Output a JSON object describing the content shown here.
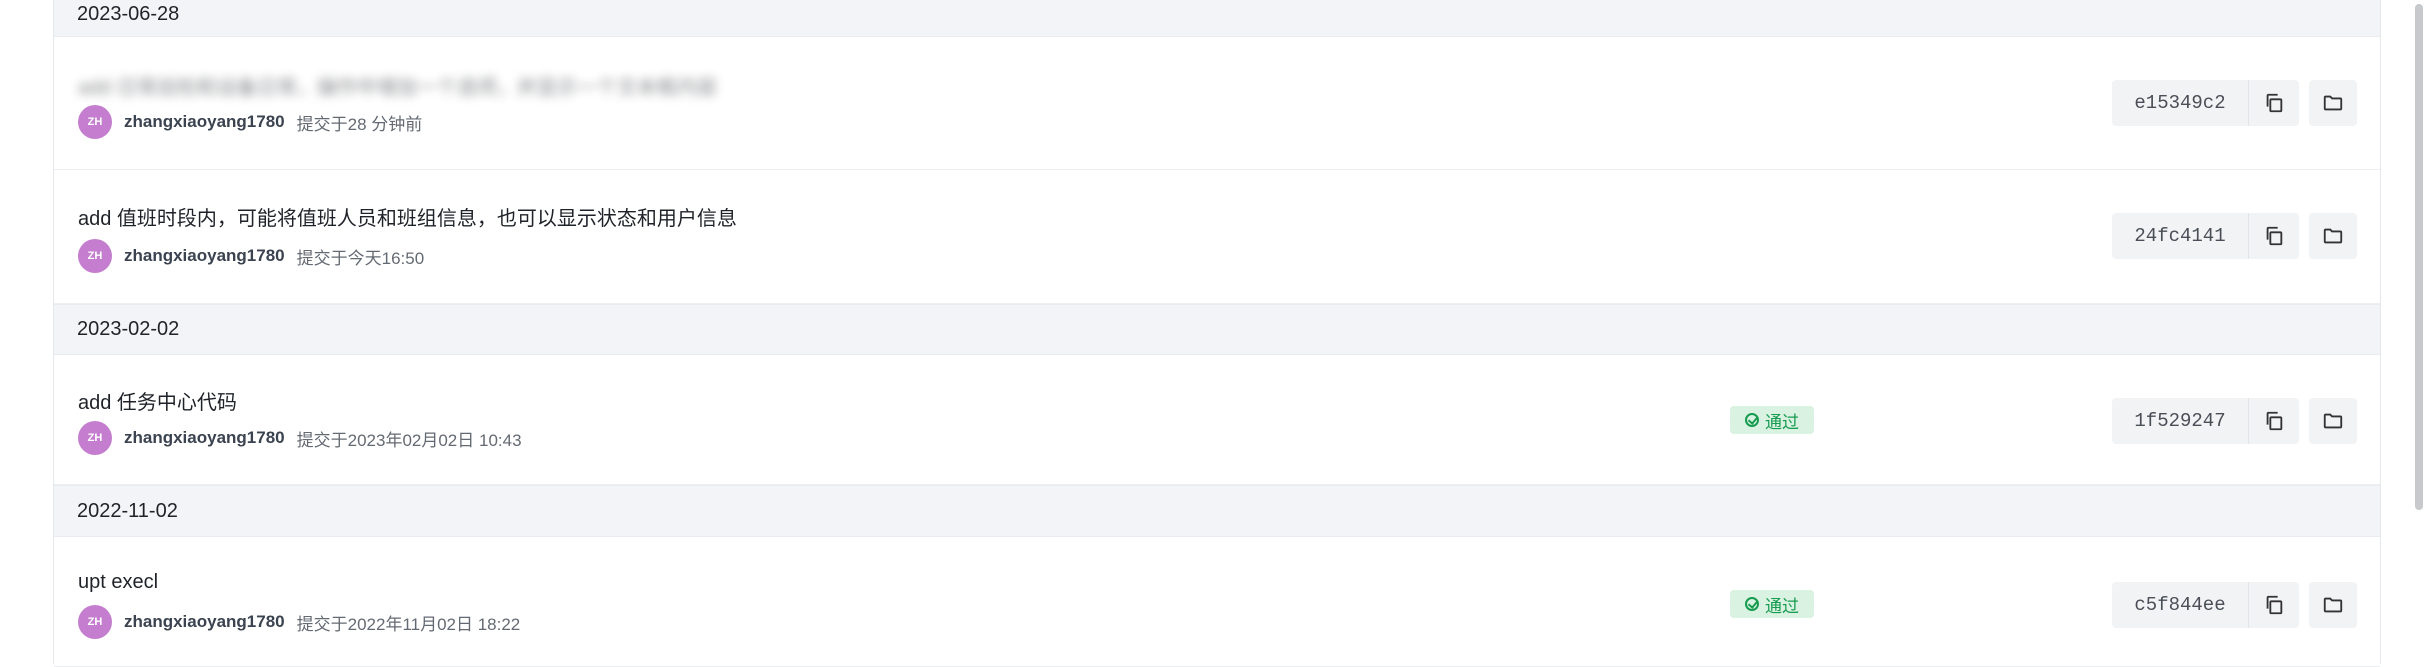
{
  "groups": [
    {
      "date": "2023-06-28",
      "commits": [
        {
          "title": "add 日常巡检和设备日常，操作中增加一个选项，并显示一个文本框内容",
          "title_blurred": true,
          "avatar": "ZH",
          "author": "zhangxiaoyang1780",
          "time": "提交于28 分钟前",
          "status": "",
          "sha": "e15349c2"
        },
        {
          "title": "add 值班时段内，可能将值班人员和班组信息，也可以显示状态和用户信息",
          "title_blurred": true,
          "avatar": "ZH",
          "author": "zhangxiaoyang1780",
          "time": "提交于今天16:50",
          "status": "",
          "sha": "24fc4141"
        }
      ]
    },
    {
      "date": "2023-02-02",
      "commits": [
        {
          "title": "add 任务中心代码",
          "title_blurred": false,
          "avatar": "ZH",
          "author": "zhangxiaoyang1780",
          "time": "提交于2023年02月02日 10:43",
          "status": "通过",
          "sha": "1f529247"
        }
      ]
    },
    {
      "date": "2022-11-02",
      "commits": [
        {
          "title": "upt execl",
          "title_blurred": false,
          "avatar": "ZH",
          "author": "zhangxiaoyang1780",
          "time": "提交于2022年11月02日 18:22",
          "status": "通过",
          "sha": "c5f844ee"
        }
      ]
    }
  ],
  "icons": {
    "copy": "copy-icon",
    "folder": "folder-icon",
    "status": "check-circle-icon"
  },
  "colors": {
    "header_bg": "#f2f4f7",
    "avatar": "#c57ecf",
    "status_bg": "#d9f2e1",
    "status_fg": "#179b50"
  }
}
